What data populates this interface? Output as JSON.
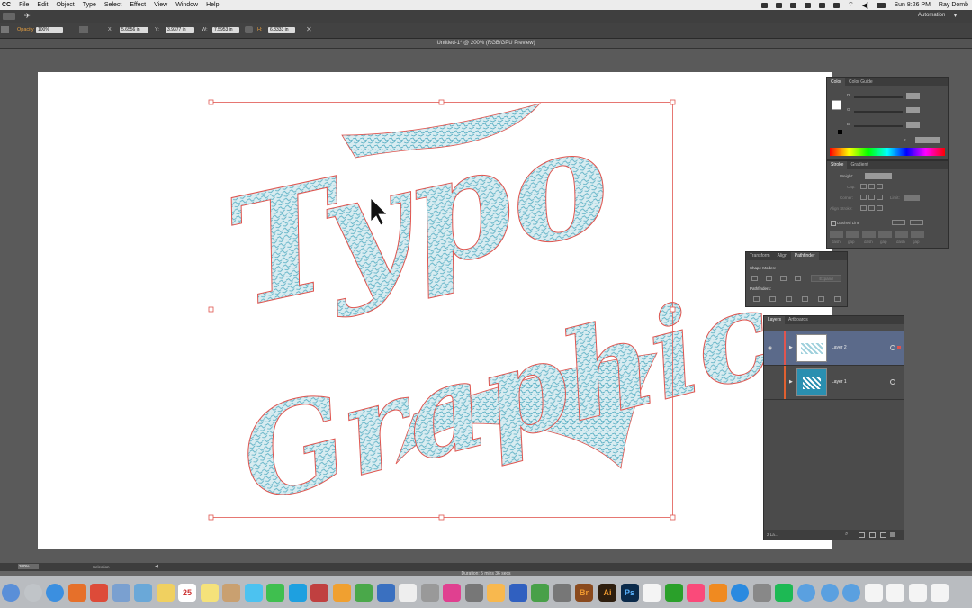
{
  "menubar": {
    "app_short": "CC",
    "items": [
      "File",
      "Edit",
      "Object",
      "Type",
      "Select",
      "Effect",
      "View",
      "Window",
      "Help"
    ],
    "clock": "Sun 8:26 PM",
    "user": "Ray Domb"
  },
  "appbar": {
    "workspace": "Automation"
  },
  "controlbar": {
    "opacity_label": "Opacity",
    "opacity_value": "100%",
    "x_label": "X:",
    "x_value": "5.6556 in",
    "y_label": "Y:",
    "y_value": "3.9377 in",
    "w_label": "W:",
    "w_value": "7.5953 in",
    "h_label": "H:",
    "h_value": "6.8333 in"
  },
  "document": {
    "title": "Untitled-1* @ 200% (RGB/GPU Preview)"
  },
  "artwork": {
    "line1": "Typo",
    "line2": "Graphic"
  },
  "color_panel": {
    "tabs": [
      "Color",
      "Color Guide"
    ],
    "channels": [
      "R",
      "G",
      "B"
    ],
    "hex_label": "#"
  },
  "stroke_panel": {
    "tabs": [
      "Stroke",
      "Gradient"
    ],
    "weight_label": "Weight:",
    "cap_label": "Cap:",
    "corner_label": "Corner:",
    "limit_label": "Limit:",
    "align_label": "Align Stroke:",
    "dashed_label": "Dashed Line",
    "dash_labels": [
      "dash",
      "gap",
      "dash",
      "gap",
      "dash",
      "gap"
    ]
  },
  "pathfinder_panel": {
    "tabs": [
      "Transform",
      "Align",
      "Pathfinder"
    ],
    "shape_modes_label": "Shape Modes:",
    "expand_label": "Expand",
    "pathfinders_label": "Pathfinders:"
  },
  "layers_panel": {
    "tabs": [
      "Layers",
      "Artboards"
    ],
    "layers": [
      {
        "name": "Layer 2"
      },
      {
        "name": "Layer 1"
      }
    ],
    "count_label": "2 La..."
  },
  "statusbar": {
    "zoom": "200%",
    "tool": "Selection",
    "duration": "Duration: 5 mins 36 secs"
  },
  "colors": {
    "artwork_fill": "#5ab0c4",
    "selection_red": "#e0554f",
    "layer2_highlight": "#5b6a8a",
    "layer1_bar": "#e06030"
  },
  "dock_icons": [
    "finder-icon",
    "launchpad-icon",
    "safari-icon",
    "firefox-icon",
    "chrome-icon",
    "mail-icon",
    "preview-icon",
    "notes-icon",
    "calendar-icon",
    "stickies-icon",
    "contacts-icon",
    "messages-icon",
    "facetime-icon",
    "skype-icon",
    "photo-booth-icon",
    "pages-icon",
    "numbers-icon",
    "keynote-icon",
    "textedit-icon",
    "script-editor-icon",
    "color-wheel-icon",
    "screenshot-icon",
    "photos-icon",
    "vpn-icon",
    "maps-icon",
    "help-icon",
    "bridge-icon",
    "illustrator-icon",
    "photoshop-icon",
    "document-icon",
    "quickbooks-icon",
    "itunes-icon",
    "ibooks-icon",
    "app-store-icon",
    "system-preferences-icon",
    "spotify-icon",
    "folder-icon",
    "folder-icon",
    "folder-icon",
    "document-icon",
    "document-icon",
    "document-icon",
    "document-icon"
  ],
  "dock_labels": {
    "calendar_day": "25",
    "bridge": "Br",
    "illustrator": "Ai",
    "photoshop": "Ps"
  }
}
